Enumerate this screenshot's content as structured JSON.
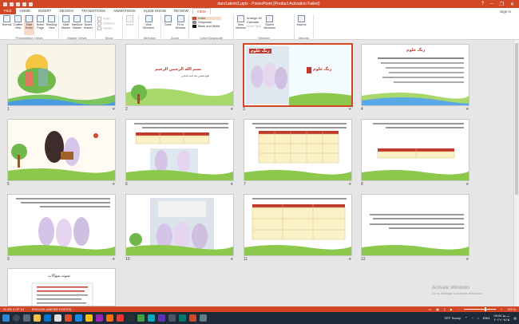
{
  "titlebar": {
    "title": "dars1akom1.pptx - PowerPoint (Product Activation Failed)",
    "controls": {
      "help": "?",
      "minimize": "–",
      "restore": "❐",
      "close": "✕"
    }
  },
  "tabs": [
    "FILE",
    "HOME",
    "INSERT",
    "DESIGN",
    "TRANSITIONS",
    "ANIMATIONS",
    "SLIDE SHOW",
    "REVIEW",
    "VIEW"
  ],
  "active_tab": "VIEW",
  "signin": "Sign in",
  "ribbon": {
    "presentation_views": {
      "label": "Presentation Views",
      "buttons": [
        "Normal",
        "Outline View",
        "Slide Sorter",
        "Notes Page",
        "Reading View"
      ]
    },
    "master_views": {
      "label": "Master Views",
      "buttons": [
        "Slide Master",
        "Handout Master",
        "Notes Master"
      ]
    },
    "show": {
      "label": "Show",
      "items": [
        "Ruler",
        "Gridlines",
        "Guides"
      ]
    },
    "notes_btn": "Notes",
    "direction": {
      "label": "Direction",
      "button": "View Direction"
    },
    "zoom": {
      "label": "Zoom",
      "buttons": [
        "Zoom",
        "Fit to Window"
      ]
    },
    "color": {
      "label": "Color/Grayscale",
      "items": [
        "Color",
        "Grayscale",
        "Black and White"
      ],
      "colors": [
        "#d24726",
        "#888888",
        "#111111"
      ]
    },
    "window": {
      "label": "Window",
      "new_window": "New Window",
      "items": [
        "Arrange All",
        "Cascade",
        "Move Split"
      ],
      "switch": "Switch Windows"
    },
    "macros": {
      "label": "Macros",
      "button": "Macros"
    }
  },
  "slides": [
    {
      "num": "1",
      "star": "★",
      "title": "",
      "text": ""
    },
    {
      "num": "2",
      "star": "★",
      "title": "بسم الله الرحمن الرحيم",
      "text": "اللهم العلمين بعلم الحمد الملايين"
    },
    {
      "num": "3",
      "star": "★",
      "title": "زنگ علوم",
      "text": "زنگ علوم"
    },
    {
      "num": "4",
      "star": "★",
      "title": "زنگ علوم",
      "text": ""
    },
    {
      "num": "5",
      "star": "★",
      "title": "",
      "text": ""
    },
    {
      "num": "6",
      "star": "★",
      "title": "",
      "text": ""
    },
    {
      "num": "7",
      "star": "★",
      "title": "",
      "text": ""
    },
    {
      "num": "8",
      "star": "★",
      "title": "",
      "text": ""
    },
    {
      "num": "9",
      "star": "★",
      "title": "",
      "text": ""
    },
    {
      "num": "10",
      "star": "★",
      "title": "",
      "text": ""
    },
    {
      "num": "11",
      "star": "★",
      "title": "",
      "text": ""
    },
    {
      "num": "12",
      "star": "★",
      "title": "",
      "text": ""
    },
    {
      "num": "13",
      "star": "★",
      "title": "نمونه سوالات",
      "text": ""
    }
  ],
  "status": {
    "slide_info": "SLIDE 3 OF 13",
    "language": "ENGLISH (UNITED STATES)",
    "zoom": "125 %"
  },
  "activate": {
    "title": "Activate Windows",
    "sub": "Go to Settings to activate Windows."
  },
  "taskbar": {
    "weather": "78°F  Sunny",
    "lang": "ENG",
    "time": "09:00 ب.ظ",
    "date": "۲۰۲۱/۰۸/۱۵"
  }
}
